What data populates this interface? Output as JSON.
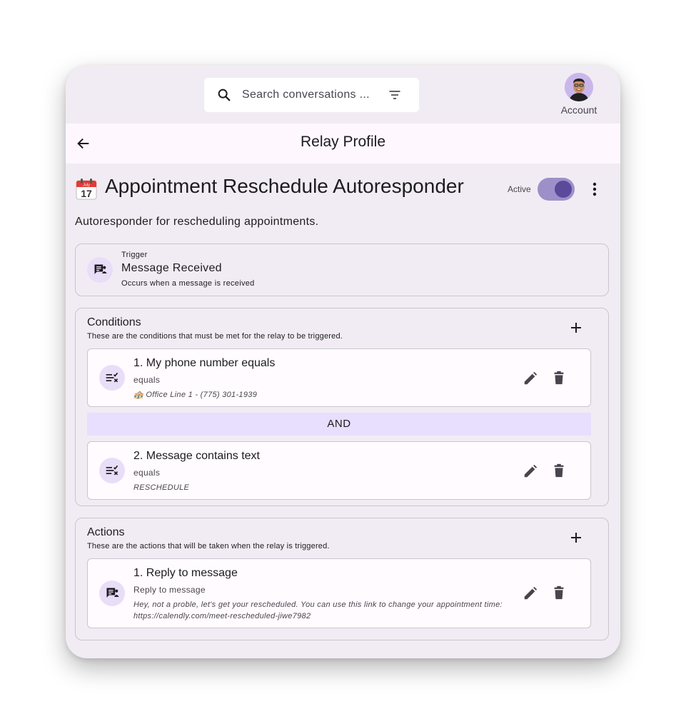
{
  "topbar": {
    "search_placeholder": "Search conversations ...",
    "account_label": "Account"
  },
  "header": {
    "title": "Relay Profile"
  },
  "profile": {
    "title": "Appointment Reschedule Autoresponder",
    "calendar_icon_text": "17",
    "calendar_month": "July",
    "active_label": "Active",
    "active": true,
    "description": "Autoresponder for rescheduling appointments."
  },
  "trigger": {
    "label": "Trigger",
    "name": "Message Received",
    "description": "Occurs when a message is received"
  },
  "conditions": {
    "title": "Conditions",
    "subtitle": "These are the conditions that must be met for the relay to be triggered.",
    "items": [
      {
        "title": "1. My phone number equals",
        "operator": "equals",
        "value": "🏤 Office Line 1 - (775) 301-1939"
      },
      {
        "title": "2. Message contains text",
        "operator": "equals",
        "value": "RESCHEDULE"
      }
    ],
    "joiner": "AND"
  },
  "actions": {
    "title": "Actions",
    "subtitle": "These are the actions that will be taken when the relay is triggered.",
    "items": [
      {
        "title": "1. Reply to message",
        "type": "Reply to message",
        "message": "Hey, not a proble, let's get your rescheduled. You can use this link to change your appointment time: https://calendly.com/meet-rescheduled-jiwe7982"
      }
    ]
  },
  "colors": {
    "background": "#f1ecf3",
    "accent": "#5b4a9a",
    "toggle_track": "#9d90c9",
    "and_bar": "#e8defd",
    "icon_bg": "#e8def8"
  }
}
